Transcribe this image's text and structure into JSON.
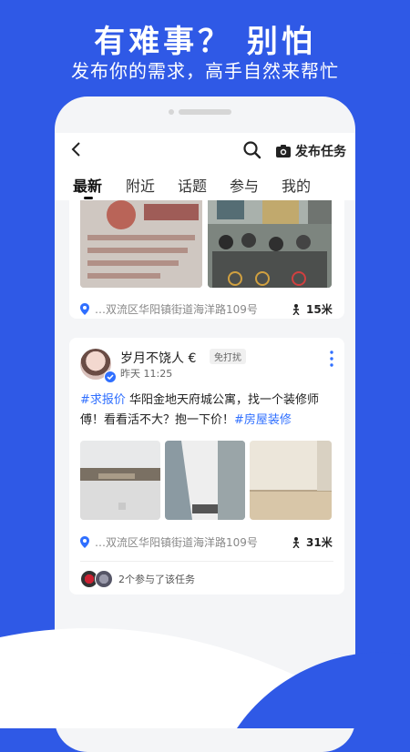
{
  "hero": {
    "title": "有难事？ 别怕",
    "subtitle": "发布你的需求，高手自然来帮忙"
  },
  "nav": {
    "publish_label": "发布任务"
  },
  "tabs": [
    {
      "label": "最新",
      "active": true
    },
    {
      "label": "附近",
      "active": false
    },
    {
      "label": "话题",
      "active": false
    },
    {
      "label": "参与",
      "active": false
    },
    {
      "label": "我的",
      "active": false
    }
  ],
  "card1": {
    "location": "…双流区华阳镇街道海洋路109号",
    "distance": "15米"
  },
  "card2": {
    "username": "岁月不饶人 €",
    "badge": "免打扰",
    "time": "昨天 11:25",
    "post_tag1": "#求报价",
    "post_text": " 华阳金地天府城公寓，找一个装修师傅！看看活不大？抱一下价！",
    "post_tag2": "#房屋装修",
    "location": "…双流区华阳镇街道海洋路109号",
    "distance": "31米"
  },
  "participants": {
    "text": "2个参与了该任务"
  },
  "colors": {
    "brand_blue": "#2f59e6",
    "tag_blue": "#2f6fff"
  },
  "icons": [
    "back-icon",
    "search-icon",
    "camera-icon",
    "location-pin-icon",
    "walk-icon",
    "more-vertical-icon",
    "verified-icon"
  ]
}
